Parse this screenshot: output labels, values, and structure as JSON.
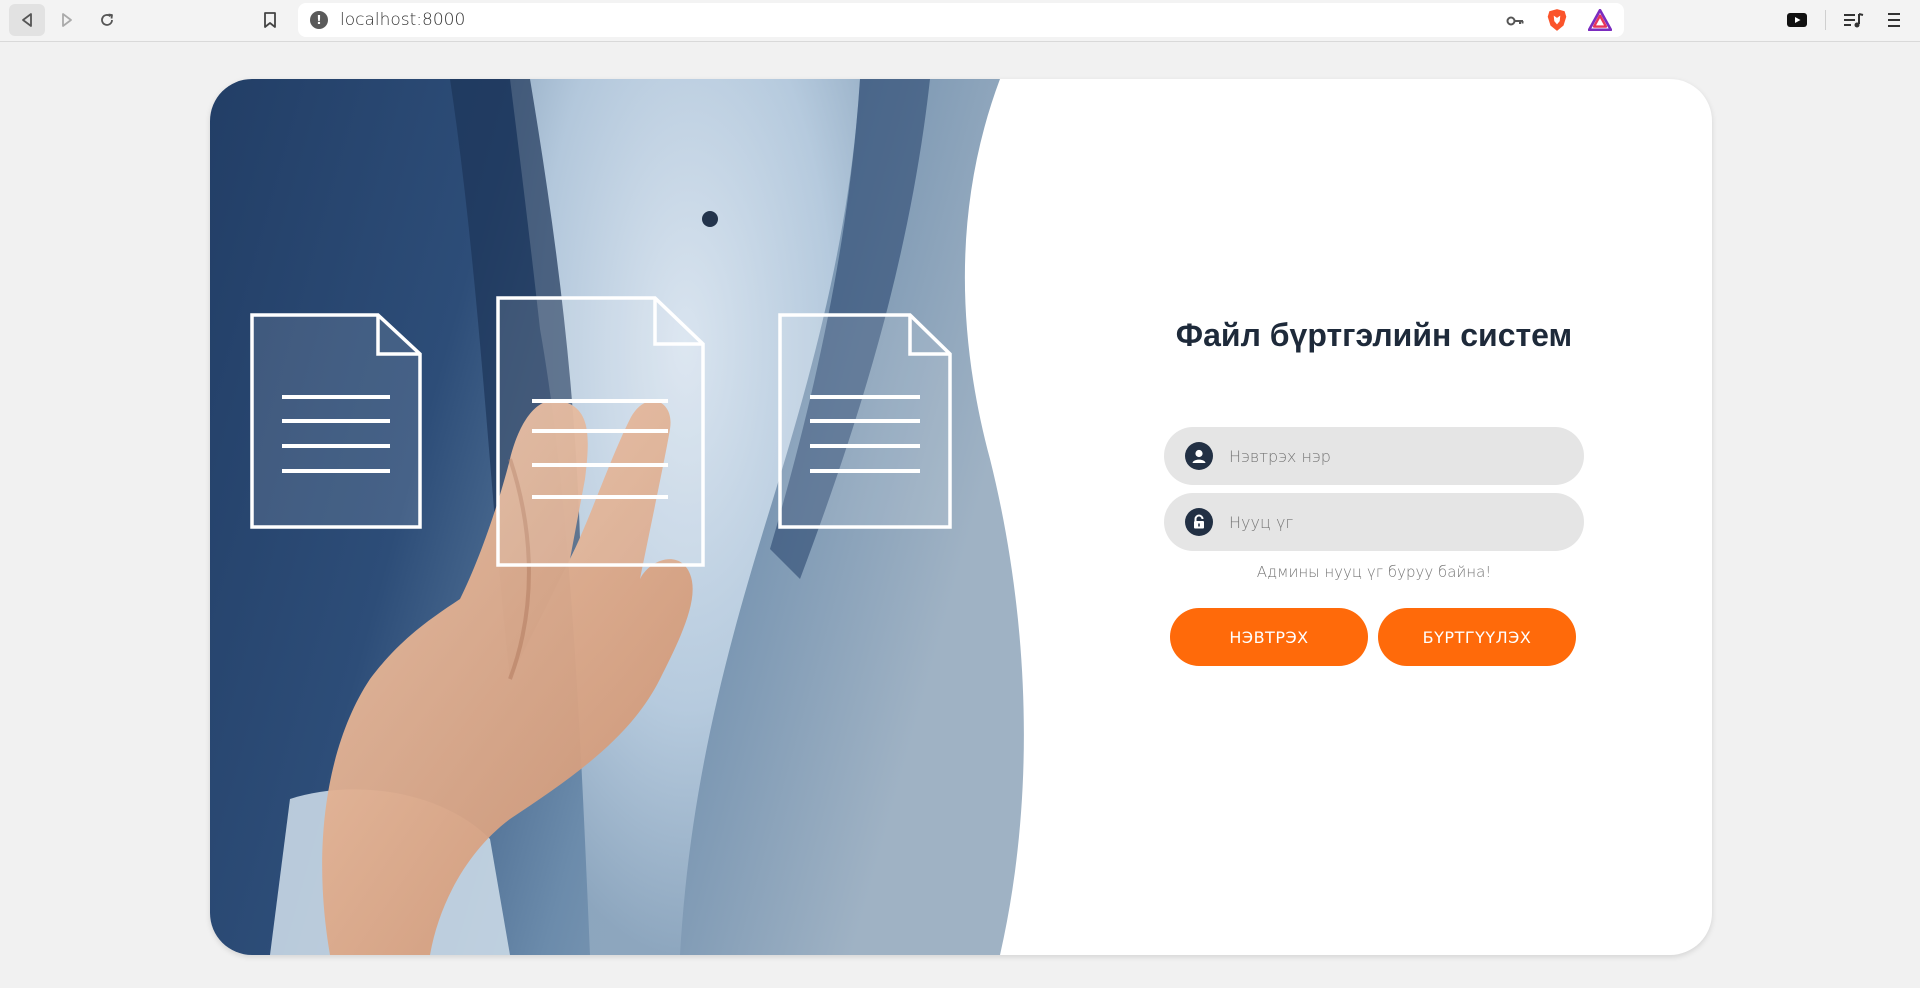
{
  "browser": {
    "url": "localhost:8000"
  },
  "login": {
    "title": "Файл бүртгэлийн систем",
    "username_placeholder": "Нэвтрэх нэр",
    "password_placeholder": "Нууц үг",
    "error_message": "Админы нууц үг буруу байна!",
    "login_button": "НЭВТРЭХ",
    "register_button": "БҮРТГҮҮЛЭХ"
  },
  "colors": {
    "accent": "#ff6a0a",
    "input_bg": "#e5e5e5",
    "icon_bg": "#223044",
    "title": "#1e2a3a"
  },
  "icons": {
    "back": "back-arrow-icon",
    "forward": "forward-arrow-icon",
    "reload": "reload-icon",
    "bookmark": "bookmark-icon",
    "site_info": "info-icon",
    "key": "key-icon",
    "brave": "brave-shield-icon",
    "rewards": "brave-rewards-icon",
    "youtube": "youtube-icon",
    "media": "media-playlist-icon",
    "menu": "menu-icon",
    "username": "user-icon",
    "password": "lock-icon"
  }
}
